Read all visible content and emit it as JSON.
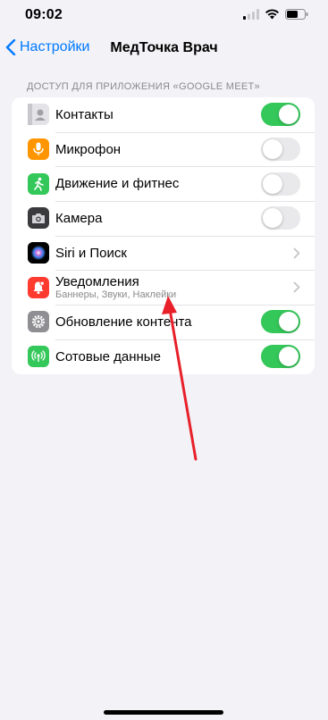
{
  "status": {
    "time": "09:02"
  },
  "nav": {
    "back_label": "Настройки",
    "title": "МедТочка Врач"
  },
  "section": {
    "header": "ДОСТУП ДЛЯ ПРИЛОЖЕНИЯ «GOOGLE MEET»"
  },
  "rows": [
    {
      "label": "Контакты",
      "control": "toggle",
      "on": true,
      "icon": "contacts-icon",
      "icon_color": "#c7c7cc"
    },
    {
      "label": "Микрофон",
      "control": "toggle",
      "on": false,
      "icon": "microphone-icon",
      "icon_color": "#ff9500"
    },
    {
      "label": "Движение и фитнес",
      "control": "toggle",
      "on": false,
      "icon": "fitness-icon",
      "icon_color": "#34c759"
    },
    {
      "label": "Камера",
      "control": "toggle",
      "on": false,
      "icon": "camera-icon",
      "icon_color": "#3a3a3c"
    },
    {
      "label": "Siri и Поиск",
      "control": "chevron",
      "icon": "siri-icon",
      "icon_color": "#1c1c1e"
    },
    {
      "label": "Уведомления",
      "sublabel": "Баннеры, Звуки, Наклейки",
      "control": "chevron",
      "icon": "notifications-icon",
      "icon_color": "#ff3b30"
    },
    {
      "label": "Обновление контента",
      "control": "toggle",
      "on": true,
      "icon": "gear-icon",
      "icon_color": "#8e8e93"
    },
    {
      "label": "Сотовые данные",
      "control": "toggle",
      "on": true,
      "icon": "cellular-icon",
      "icon_color": "#34c759"
    }
  ],
  "colors": {
    "accent": "#007aff",
    "toggle_on": "#34c759",
    "annotation_arrow": "#e8202a"
  }
}
